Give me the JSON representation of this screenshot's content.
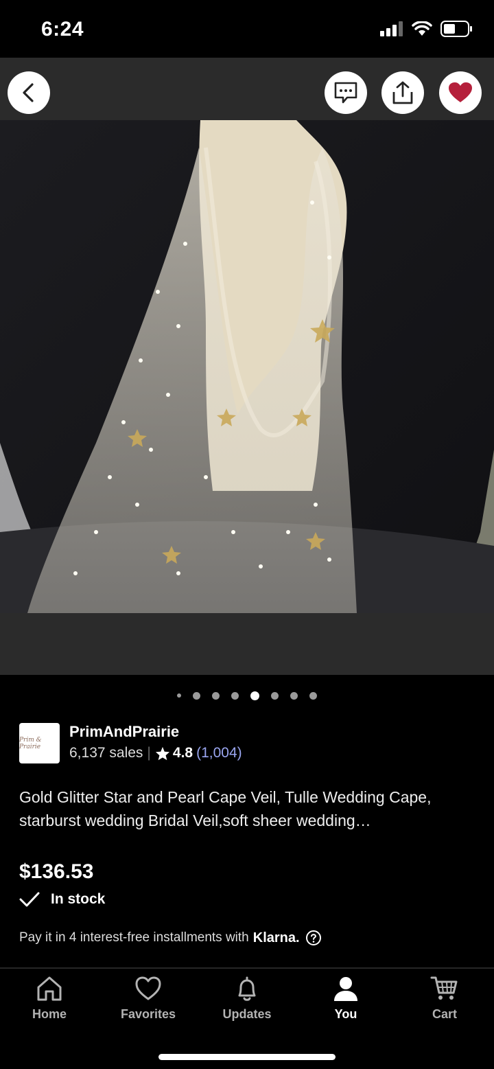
{
  "status_bar": {
    "time": "6:24"
  },
  "header": {
    "back_icon": "chevron-left-icon",
    "message_icon": "message-icon",
    "share_icon": "share-icon",
    "favorite_icon": "heart-icon",
    "favorite_color": "#b5203b"
  },
  "gallery": {
    "total_images": 8,
    "active_index": 4
  },
  "shop": {
    "logo_text": "Prim & Prairie",
    "name": "PrimAndPrairie",
    "sales": "6,137 sales",
    "rating": "4.8",
    "review_count": "(1,004)"
  },
  "listing": {
    "title": "Gold Glitter Star and Pearl Cape Veil, Tulle Wedding Cape, starburst wedding Bridal Veil,soft sheer wedding…",
    "price": "$136.53",
    "stock": "In stock",
    "installments_text": "Pay it in 4 interest-free installments with",
    "installments_brand": "Klarna."
  },
  "tabs": [
    {
      "label": "Home",
      "icon": "home-icon",
      "active": false
    },
    {
      "label": "Favorites",
      "icon": "heart-outline-icon",
      "active": false
    },
    {
      "label": "Updates",
      "icon": "bell-icon",
      "active": false
    },
    {
      "label": "You",
      "icon": "person-icon",
      "active": true
    },
    {
      "label": "Cart",
      "icon": "cart-icon",
      "active": false
    }
  ]
}
